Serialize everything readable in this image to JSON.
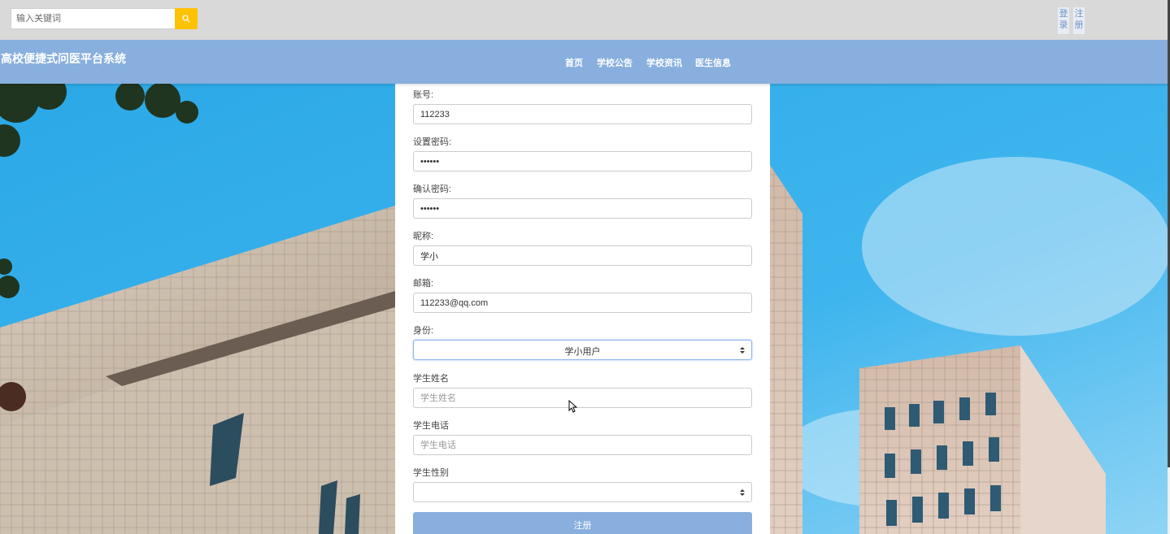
{
  "top_bar": {
    "search_placeholder": "输入关键词",
    "search_icon": "search-icon",
    "login_label": "登录",
    "register_label": "注册"
  },
  "navbar": {
    "site_title": "高校便捷式问医平台系统",
    "items": [
      "首页",
      "学校公告",
      "学校资讯",
      "医生信息"
    ]
  },
  "form": {
    "fields": [
      {
        "label": "账号:",
        "value": "112233",
        "placeholder": ""
      },
      {
        "label": "设置密码:",
        "value": "••••••",
        "placeholder": ""
      },
      {
        "label": "确认密码:",
        "value": "••••••",
        "placeholder": ""
      },
      {
        "label": "昵称:",
        "value": "学小",
        "placeholder": ""
      },
      {
        "label": "邮箱:",
        "value": "112233@qq.com",
        "placeholder": ""
      },
      {
        "label": "身份:",
        "value": "学小用户",
        "placeholder": ""
      },
      {
        "label": "学生姓名",
        "value": "",
        "placeholder": "学生姓名"
      },
      {
        "label": "学生电话",
        "value": "",
        "placeholder": "学生电话"
      },
      {
        "label": "学生性别",
        "value": "",
        "placeholder": ""
      }
    ],
    "submit_label": "注册"
  },
  "colors": {
    "nav_blue": "#88afde",
    "search_yellow": "#ffc200",
    "top_gray": "#d9d9d9"
  }
}
